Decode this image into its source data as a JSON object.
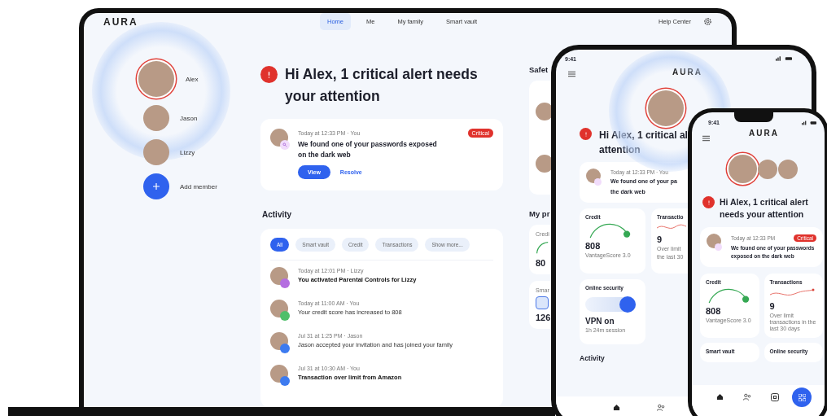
{
  "laptop": {
    "logo": "AURA",
    "nav": [
      {
        "label": "Home",
        "selected": true
      },
      {
        "label": "Me",
        "selected": false
      },
      {
        "label": "My family",
        "selected": false
      },
      {
        "label": "Smart vault",
        "selected": false
      }
    ],
    "help": "Help Center",
    "members": [
      {
        "name": "Alex",
        "alert": true
      },
      {
        "name": "Jason",
        "alert": false
      },
      {
        "name": "Lizzy",
        "alert": false
      }
    ],
    "add_member": "Add member",
    "alert": {
      "heading": "Hi Alex, 1 critical alert needs your attention",
      "time": "Today at 12:33 PM · You",
      "badge": "Critical",
      "message": "We found one of your passwords exposed on the dark web",
      "primary": "View",
      "secondary": "Resolve"
    },
    "activity": {
      "title": "Activity",
      "filters": [
        {
          "label": "All",
          "selected": true
        },
        {
          "label": "Smart vault",
          "selected": false
        },
        {
          "label": "Credit",
          "selected": false
        },
        {
          "label": "Transactions",
          "selected": false
        },
        {
          "label": "Show more...",
          "selected": false
        }
      ],
      "items": [
        {
          "time": "Today at 12:01 PM · Lizzy",
          "text": "You activated Parental Controls for Lizzy",
          "unread": true,
          "color": "#b46ee0"
        },
        {
          "time": "Today at 11:00 AM · You",
          "text": "Your credit score has increased to 808",
          "unread": false,
          "color": "#4fbf6a"
        },
        {
          "time": "Jul 31 at 1:25 PM · Jason",
          "text": "Jason accepted your invitation and has joined your family",
          "unread": false,
          "color": "#3d7bf0"
        },
        {
          "time": "Jul 31 at 10:30 AM · You",
          "text": "Transaction over limit from Amazon",
          "unread": true,
          "color": "#3d7bf0"
        }
      ]
    },
    "side": {
      "safety_title": "Safet",
      "products_title": "My pr",
      "credit_label": "Credi",
      "credit_value": "80",
      "vault_label": "Smar",
      "vault_value": "126"
    }
  },
  "phone_large": {
    "time": "9:41",
    "logo": "AURA",
    "heading": "Hi Alex, 1 critical al",
    "heading_line2": "attention",
    "card_time": "Today at 12:33 PM · You",
    "card_message": "We found one of your pa",
    "card_message_line2": "the dark web",
    "credit": {
      "label": "Credit",
      "value": "808",
      "note": "VantageScore 3.0"
    },
    "transactions": {
      "label": "Transactio",
      "value": "9",
      "note": "Over limit",
      "note_line2": "the last 30"
    },
    "security": {
      "label": "Online security",
      "value": "VPN on",
      "note": "1h 24m session"
    },
    "activity_title": "Activity"
  },
  "phone_small": {
    "time": "9:41",
    "logo": "AURA",
    "heading": "Hi Alex, 1 critical alert needs your attention",
    "card_time": "Today at 12:33 PM",
    "card_badge": "Critical",
    "card_message": "We found one of your passwords exposed on the dark web",
    "credit": {
      "label": "Credit",
      "value": "808",
      "note": "VantageScore 3.0"
    },
    "transactions": {
      "label": "Transactions",
      "value": "9",
      "note": "Over limit transactions in the last 30 days"
    },
    "tiles": [
      "Smart vault",
      "Online security"
    ]
  }
}
